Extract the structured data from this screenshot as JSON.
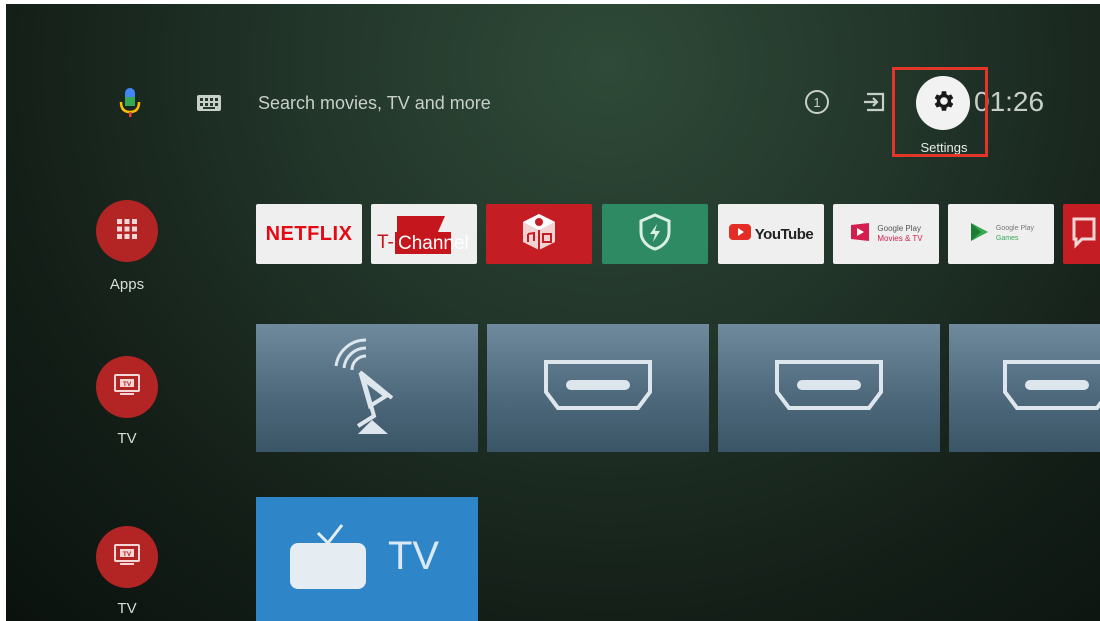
{
  "search": {
    "placeholder": "Search movies, TV and more"
  },
  "top_bar": {
    "settings_label": "Settings",
    "clock": "01:26",
    "icons": [
      "mic-icon",
      "keyboard-icon",
      "info-icon",
      "input-source-icon",
      "gear-icon"
    ]
  },
  "sidebar": {
    "items": [
      {
        "label": "Apps",
        "icon": "grid-icon"
      },
      {
        "label": "TV",
        "icon": "tv-icon"
      },
      {
        "label": "TV",
        "icon": "tv-icon"
      }
    ],
    "tv_badge": "TV"
  },
  "apps_row": {
    "tiles": [
      {
        "name": "netflix",
        "text": "NETFLIX"
      },
      {
        "name": "t-channel",
        "text_a": "T-",
        "text_b": "Channel"
      },
      {
        "name": "media-center",
        "text": ""
      },
      {
        "name": "security",
        "text": ""
      },
      {
        "name": "youtube",
        "text": "YouTube"
      },
      {
        "name": "google-play-movies",
        "line1": "Google Play",
        "line2": "Movies & TV"
      },
      {
        "name": "google-play-games",
        "line1": "Google Play",
        "line2": "Games"
      }
    ]
  },
  "inputs_row": {
    "tiles": [
      "antenna",
      "hdmi",
      "hdmi",
      "hdmi"
    ]
  },
  "tv_row": {
    "label": "TV"
  },
  "colors": {
    "accent_red": "#b32424",
    "highlight": "#e3352a",
    "netflix_red": "#e50914",
    "tv_blue": "#2e86c9"
  }
}
